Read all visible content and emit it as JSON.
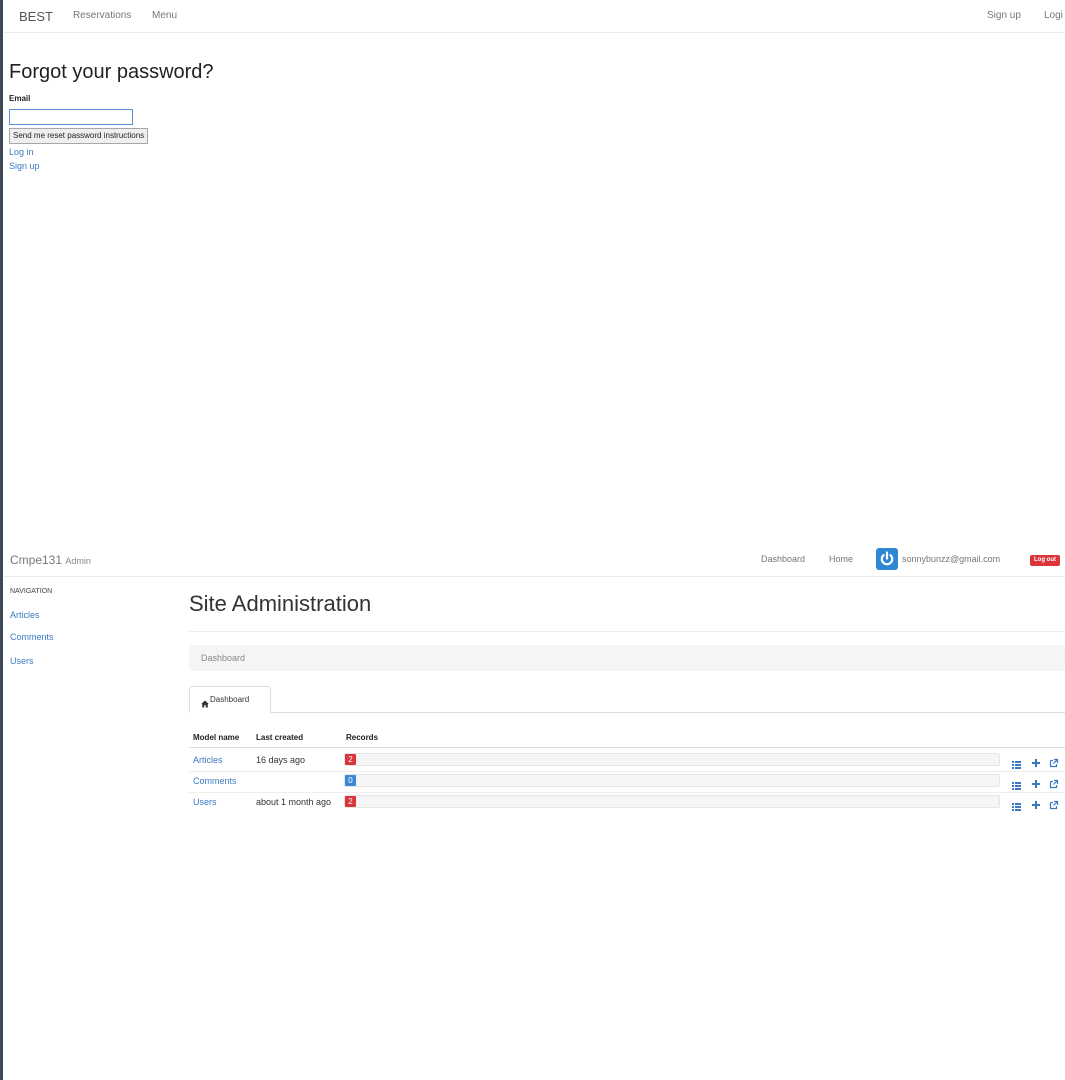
{
  "top_app": {
    "brand": "BEST",
    "nav": {
      "reservations": "Reservations",
      "menu": "Menu",
      "signup": "Sign up",
      "login": "Logi"
    },
    "form": {
      "title": "Forgot your password?",
      "email_label": "Email",
      "email_value": "",
      "submit_label": "Send me reset password instructions",
      "login_link": "Log in",
      "signup_link": "Sign up"
    }
  },
  "admin_app": {
    "brand": "Cmpe131",
    "brand_sub": "Admin",
    "nav": {
      "dashboard": "Dashboard",
      "home": "Home",
      "user_email": "sonnybunzz@gmail.com",
      "logout": "Log out"
    },
    "sidebar": {
      "heading": "NAVIGATION",
      "items": [
        {
          "label": "Articles"
        },
        {
          "label": "Comments"
        },
        {
          "label": "Users"
        }
      ]
    },
    "page_title": "Site Administration",
    "breadcrumb": "Dashboard",
    "tab": {
      "label": "Dashboard",
      "icon": "home-icon"
    },
    "table": {
      "headers": {
        "model": "Model name",
        "created": "Last created",
        "records": "Records"
      },
      "rows": [
        {
          "model": "Articles",
          "created": "16 days ago",
          "count": "2",
          "badge_color": "#d9353a"
        },
        {
          "model": "Comments",
          "created": "",
          "count": "0",
          "badge_color": "#3a8bd4"
        },
        {
          "model": "Users",
          "created": "about 1 month ago",
          "count": "2",
          "badge_color": "#d9353a"
        }
      ],
      "row_actions": [
        "list-icon",
        "plus-icon",
        "export-icon"
      ]
    }
  },
  "colors": {
    "link": "#3a7ac2",
    "danger": "#d9353a",
    "primary": "#2f87d4",
    "info": "#3a8bd4"
  }
}
